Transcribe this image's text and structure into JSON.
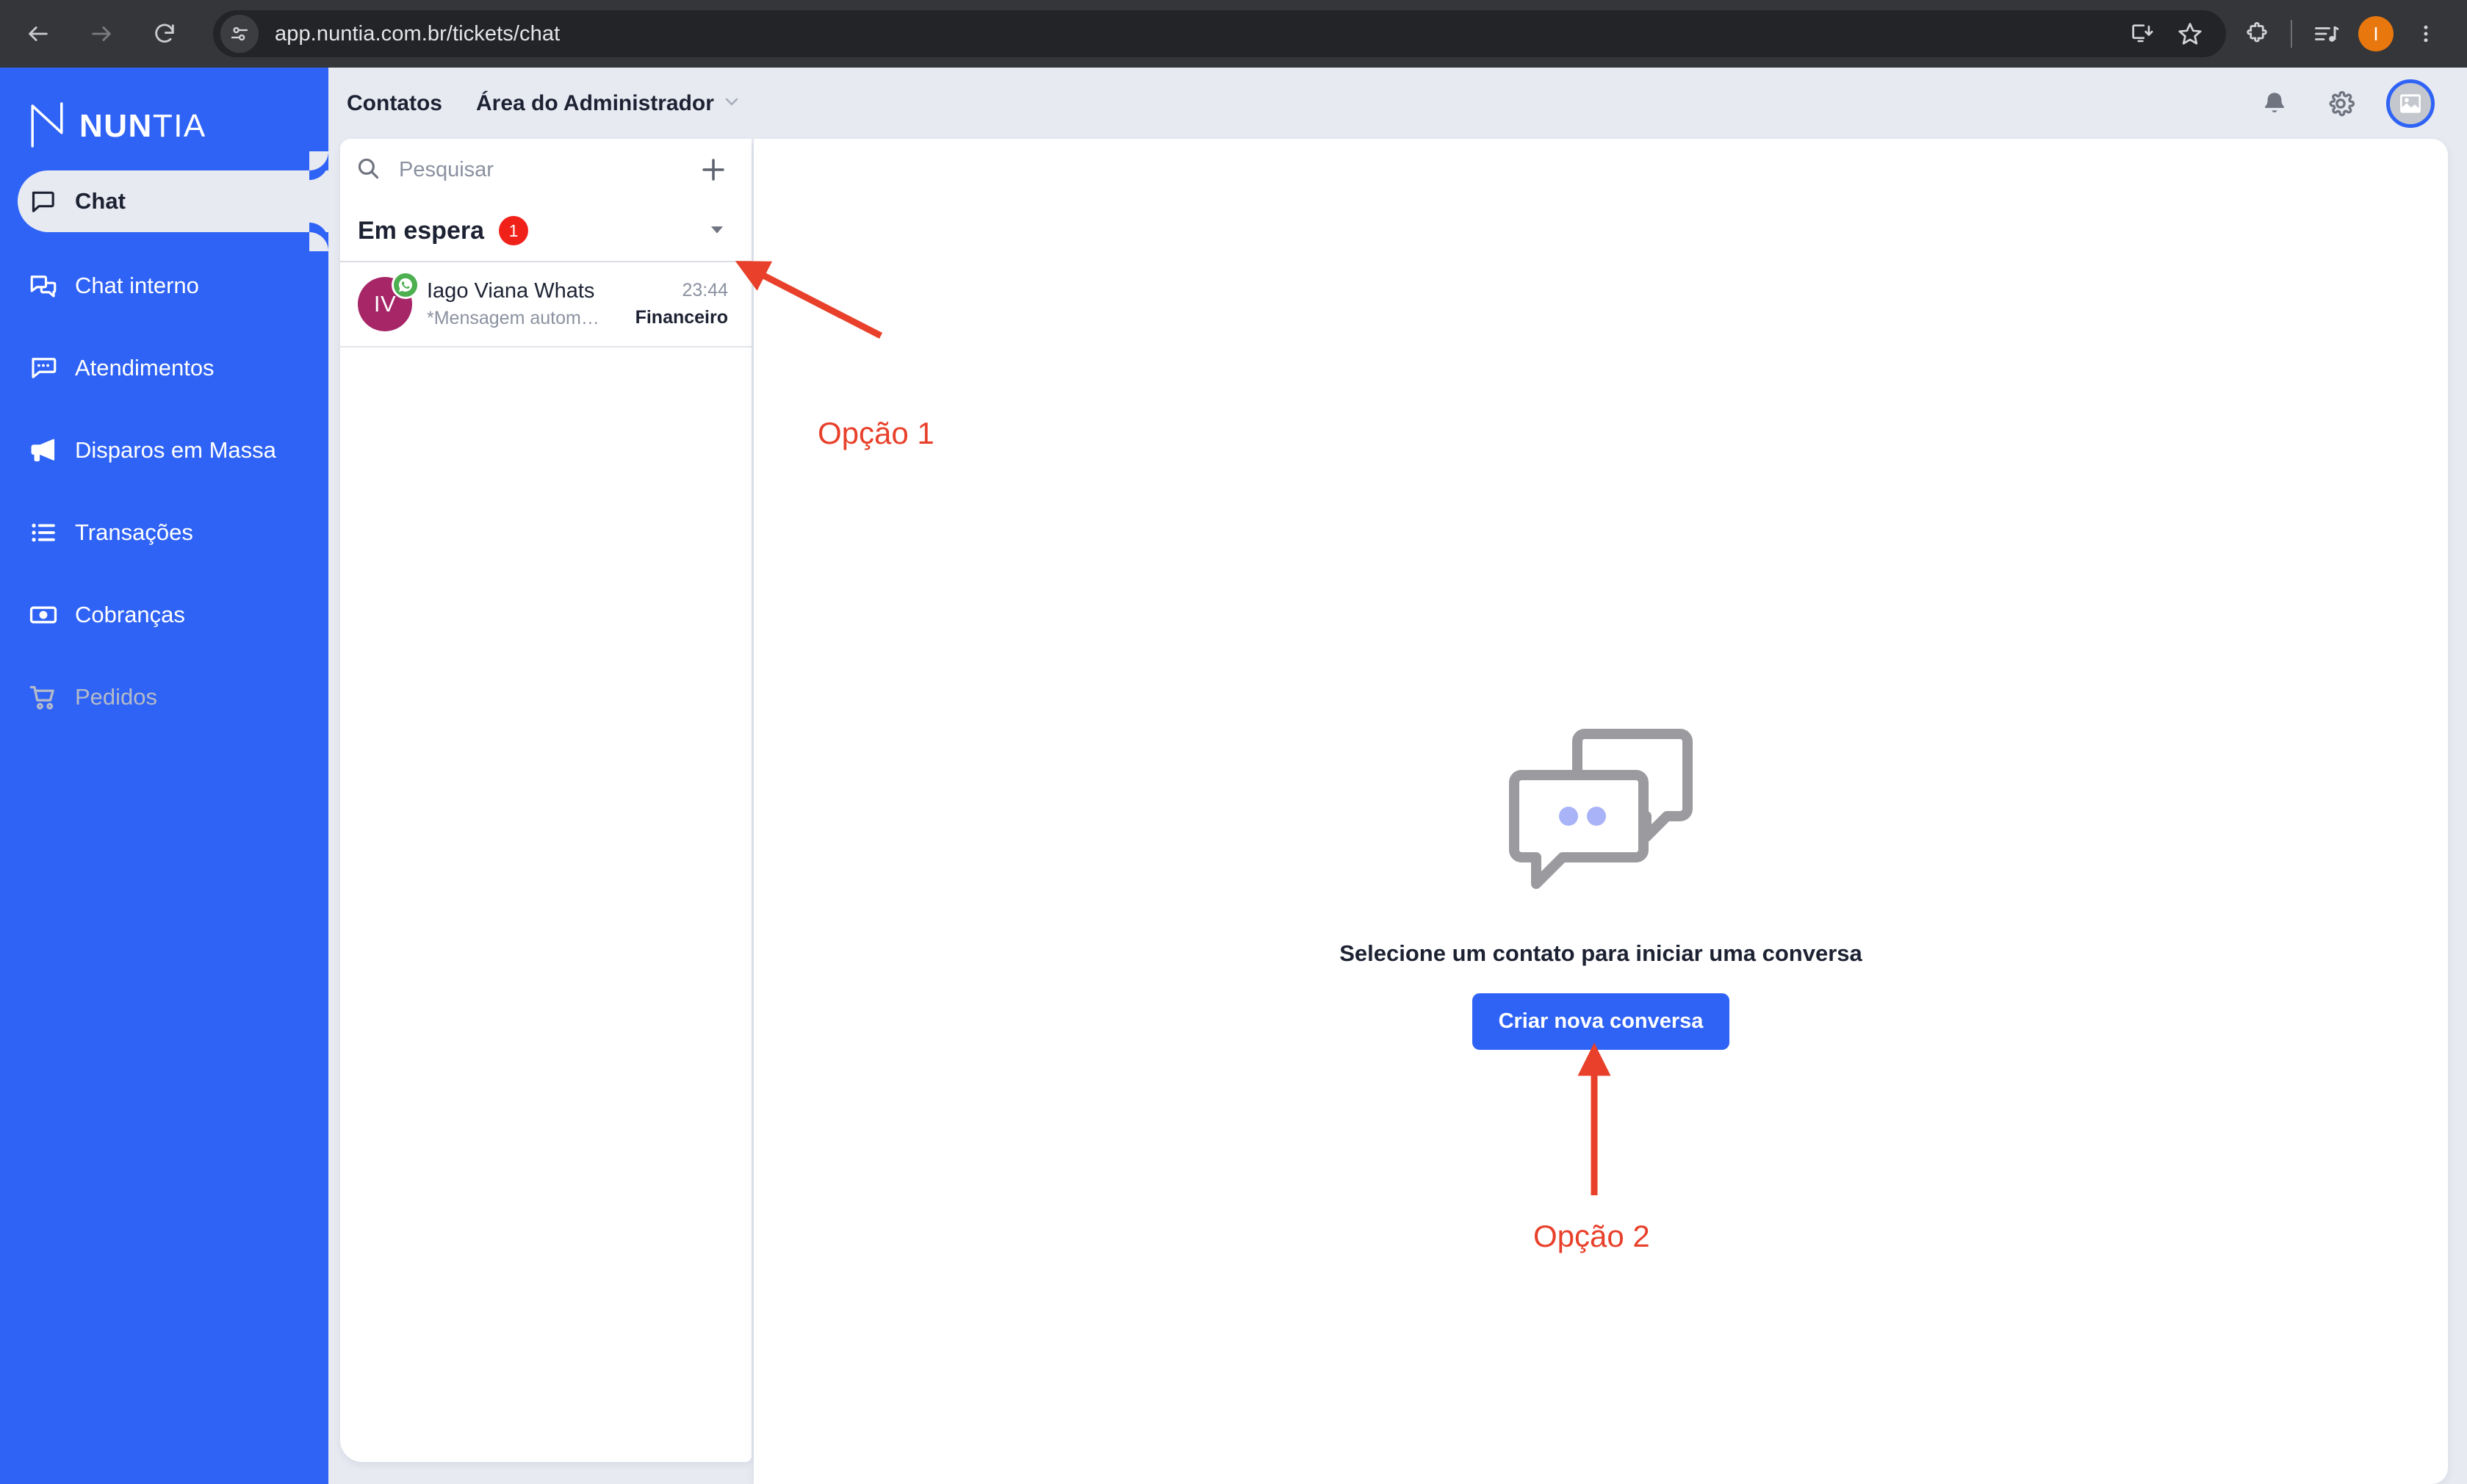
{
  "browser": {
    "url": "app.nuntia.com.br/tickets/chat",
    "back_label": "Back",
    "forward_label": "Forward",
    "reload_label": "Reload",
    "site_settings_label": "View site information",
    "install_label": "Install app",
    "bookmark_label": "Bookmark this tab",
    "extensions_label": "Extensions",
    "media_label": "Media controls",
    "profile_initial": "I",
    "menu_label": "Customize and control Chrome"
  },
  "sidebar": {
    "logo": {
      "bold_part": "NUN",
      "light_part": "TIA",
      "mark": "n-monogram-icon"
    },
    "items": [
      {
        "label": "Chat",
        "icon": "chat-bubble-icon",
        "active": true,
        "disabled": false
      },
      {
        "label": "Chat interno",
        "icon": "double-chat-bubble-icon",
        "active": false,
        "disabled": false
      },
      {
        "label": "Atendimentos",
        "icon": "chat-dots-icon",
        "active": false,
        "disabled": false
      },
      {
        "label": "Disparos em Massa",
        "icon": "megaphone-icon",
        "active": false,
        "disabled": false
      },
      {
        "label": "Transações",
        "icon": "list-icon",
        "active": false,
        "disabled": false
      },
      {
        "label": "Cobranças",
        "icon": "banknote-icon",
        "active": false,
        "disabled": false
      },
      {
        "label": "Pedidos",
        "icon": "shopping-cart-icon",
        "active": false,
        "disabled": true
      }
    ]
  },
  "topbar": {
    "contacts_label": "Contatos",
    "admin_area_label": "Área do Administrador",
    "notifications_icon": "bell-icon",
    "settings_icon": "gear-icon",
    "avatar_icon": "image-placeholder-icon"
  },
  "contact_panel": {
    "search": {
      "placeholder": "Pesquisar",
      "icon": "search-icon"
    },
    "add_button_icon": "plus-icon",
    "status": {
      "label": "Em espera",
      "count": "1",
      "badge_color": "#ef2118",
      "caret_icon": "chevron-down-icon"
    },
    "contacts": [
      {
        "initials": "IV",
        "avatar_color": "#a62668",
        "channel_icon": "whatsapp-icon",
        "channel_color": "#4caf50",
        "name": "Iago Viana Whats",
        "snippet": "*Mensagem autom…",
        "time": "23:44",
        "tag": "Financeiro"
      }
    ]
  },
  "main": {
    "empty_state": {
      "illustration": "two-chat-bubbles-icon",
      "title": "Selecione um contato para iniciar uma conversa",
      "button_label": "Criar nova conversa",
      "button_color": "#2f63f5"
    }
  },
  "annotations": {
    "color": "#e8402a",
    "items": [
      {
        "label": "Opção 1",
        "points_to": "add-conversation-button"
      },
      {
        "label": "Opção 2",
        "points_to": "create-conversation-button"
      }
    ]
  }
}
